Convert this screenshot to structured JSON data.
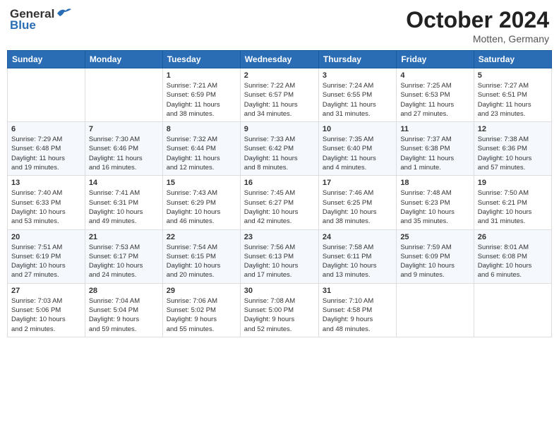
{
  "header": {
    "logo_general": "General",
    "logo_blue": "Blue",
    "month": "October 2024",
    "location": "Motten, Germany"
  },
  "weekdays": [
    "Sunday",
    "Monday",
    "Tuesday",
    "Wednesday",
    "Thursday",
    "Friday",
    "Saturday"
  ],
  "weeks": [
    [
      {
        "day": "",
        "info": ""
      },
      {
        "day": "",
        "info": ""
      },
      {
        "day": "1",
        "info": "Sunrise: 7:21 AM\nSunset: 6:59 PM\nDaylight: 11 hours\nand 38 minutes."
      },
      {
        "day": "2",
        "info": "Sunrise: 7:22 AM\nSunset: 6:57 PM\nDaylight: 11 hours\nand 34 minutes."
      },
      {
        "day": "3",
        "info": "Sunrise: 7:24 AM\nSunset: 6:55 PM\nDaylight: 11 hours\nand 31 minutes."
      },
      {
        "day": "4",
        "info": "Sunrise: 7:25 AM\nSunset: 6:53 PM\nDaylight: 11 hours\nand 27 minutes."
      },
      {
        "day": "5",
        "info": "Sunrise: 7:27 AM\nSunset: 6:51 PM\nDaylight: 11 hours\nand 23 minutes."
      }
    ],
    [
      {
        "day": "6",
        "info": "Sunrise: 7:29 AM\nSunset: 6:48 PM\nDaylight: 11 hours\nand 19 minutes."
      },
      {
        "day": "7",
        "info": "Sunrise: 7:30 AM\nSunset: 6:46 PM\nDaylight: 11 hours\nand 16 minutes."
      },
      {
        "day": "8",
        "info": "Sunrise: 7:32 AM\nSunset: 6:44 PM\nDaylight: 11 hours\nand 12 minutes."
      },
      {
        "day": "9",
        "info": "Sunrise: 7:33 AM\nSunset: 6:42 PM\nDaylight: 11 hours\nand 8 minutes."
      },
      {
        "day": "10",
        "info": "Sunrise: 7:35 AM\nSunset: 6:40 PM\nDaylight: 11 hours\nand 4 minutes."
      },
      {
        "day": "11",
        "info": "Sunrise: 7:37 AM\nSunset: 6:38 PM\nDaylight: 11 hours\nand 1 minute."
      },
      {
        "day": "12",
        "info": "Sunrise: 7:38 AM\nSunset: 6:36 PM\nDaylight: 10 hours\nand 57 minutes."
      }
    ],
    [
      {
        "day": "13",
        "info": "Sunrise: 7:40 AM\nSunset: 6:33 PM\nDaylight: 10 hours\nand 53 minutes."
      },
      {
        "day": "14",
        "info": "Sunrise: 7:41 AM\nSunset: 6:31 PM\nDaylight: 10 hours\nand 49 minutes."
      },
      {
        "day": "15",
        "info": "Sunrise: 7:43 AM\nSunset: 6:29 PM\nDaylight: 10 hours\nand 46 minutes."
      },
      {
        "day": "16",
        "info": "Sunrise: 7:45 AM\nSunset: 6:27 PM\nDaylight: 10 hours\nand 42 minutes."
      },
      {
        "day": "17",
        "info": "Sunrise: 7:46 AM\nSunset: 6:25 PM\nDaylight: 10 hours\nand 38 minutes."
      },
      {
        "day": "18",
        "info": "Sunrise: 7:48 AM\nSunset: 6:23 PM\nDaylight: 10 hours\nand 35 minutes."
      },
      {
        "day": "19",
        "info": "Sunrise: 7:50 AM\nSunset: 6:21 PM\nDaylight: 10 hours\nand 31 minutes."
      }
    ],
    [
      {
        "day": "20",
        "info": "Sunrise: 7:51 AM\nSunset: 6:19 PM\nDaylight: 10 hours\nand 27 minutes."
      },
      {
        "day": "21",
        "info": "Sunrise: 7:53 AM\nSunset: 6:17 PM\nDaylight: 10 hours\nand 24 minutes."
      },
      {
        "day": "22",
        "info": "Sunrise: 7:54 AM\nSunset: 6:15 PM\nDaylight: 10 hours\nand 20 minutes."
      },
      {
        "day": "23",
        "info": "Sunrise: 7:56 AM\nSunset: 6:13 PM\nDaylight: 10 hours\nand 17 minutes."
      },
      {
        "day": "24",
        "info": "Sunrise: 7:58 AM\nSunset: 6:11 PM\nDaylight: 10 hours\nand 13 minutes."
      },
      {
        "day": "25",
        "info": "Sunrise: 7:59 AM\nSunset: 6:09 PM\nDaylight: 10 hours\nand 9 minutes."
      },
      {
        "day": "26",
        "info": "Sunrise: 8:01 AM\nSunset: 6:08 PM\nDaylight: 10 hours\nand 6 minutes."
      }
    ],
    [
      {
        "day": "27",
        "info": "Sunrise: 7:03 AM\nSunset: 5:06 PM\nDaylight: 10 hours\nand 2 minutes."
      },
      {
        "day": "28",
        "info": "Sunrise: 7:04 AM\nSunset: 5:04 PM\nDaylight: 9 hours\nand 59 minutes."
      },
      {
        "day": "29",
        "info": "Sunrise: 7:06 AM\nSunset: 5:02 PM\nDaylight: 9 hours\nand 55 minutes."
      },
      {
        "day": "30",
        "info": "Sunrise: 7:08 AM\nSunset: 5:00 PM\nDaylight: 9 hours\nand 52 minutes."
      },
      {
        "day": "31",
        "info": "Sunrise: 7:10 AM\nSunset: 4:58 PM\nDaylight: 9 hours\nand 48 minutes."
      },
      {
        "day": "",
        "info": ""
      },
      {
        "day": "",
        "info": ""
      }
    ]
  ]
}
